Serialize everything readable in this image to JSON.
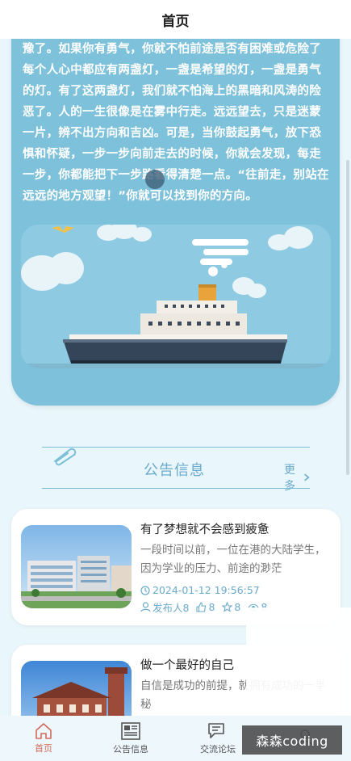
{
  "header": {
    "title": "首页"
  },
  "intro": {
    "text": "豫了。如果你有勇气，你就不怕前途是否有困难或危险了每个人心中都应有两盏灯，一盏是希望的灯，一盏是勇气的灯。有了这两盏灯，我们就不怕海上的黑暗和风涛的险恶了。人的一生很像是在雾中行走。远远望去，只是迷蒙一片，辨不出方向和吉凶。可是，当你鼓起勇气，放下恐惧和怀疑，一步一步向前走去的时候，你就会发现，每走一步，你都能把下一步路看得清楚一点。“往前走，别站在远远的地方观望！”你就可以找到你的方向。"
  },
  "notice": {
    "title": "公告信息",
    "more_label": "更多"
  },
  "news": [
    {
      "title": "有了梦想就不会感到疲惫",
      "summary": "一段时间以前，一位在港的大陆学生，因为学业的压力、前途的渺茫",
      "time": "2024-01-12 19:56:57",
      "publisher": "发布人8",
      "likes": "8",
      "favorites": "8",
      "views": "8"
    },
    {
      "title": "做一个最好的自己",
      "summary": "自信是成功的前提，就拥有成功的一半秘",
      "time": "",
      "publisher": "",
      "likes": "",
      "favorites": "",
      "views": ""
    }
  ],
  "nav": {
    "items": [
      {
        "label": "首页",
        "icon": "home-icon"
      },
      {
        "label": "公告信息",
        "icon": "newspaper-icon"
      },
      {
        "label": "交流论坛",
        "icon": "chat-icon"
      },
      {
        "label": "",
        "icon": "user-icon"
      }
    ]
  },
  "watermark": "森森coding",
  "colors": {
    "accent": "#6aaacc",
    "intro_bg": "#7ec1da",
    "active_nav": "#d06a5a"
  }
}
